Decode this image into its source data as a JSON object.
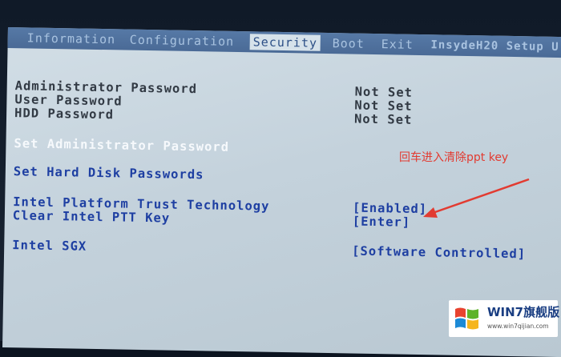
{
  "menu": {
    "tabs": [
      {
        "label": "Information"
      },
      {
        "label": "Configuration"
      },
      {
        "label": "Security"
      },
      {
        "label": "Boot"
      },
      {
        "label": "Exit"
      }
    ],
    "active_tab": "Security",
    "brand": "InsydeH20 Setup U"
  },
  "settings": [
    {
      "label": "Administrator Password",
      "value": "Not Set"
    },
    {
      "label": "User Password",
      "value": "Not Set"
    },
    {
      "label": "HDD Password",
      "value": "Not Set"
    },
    {
      "label": "Set Administrator Password"
    },
    {
      "label": "Set Hard Disk Passwords"
    },
    {
      "label": "Intel Platform Trust Technology",
      "value": "[Enabled]"
    },
    {
      "label": "Clear Intel PTT Key",
      "value": "[Enter]"
    },
    {
      "label": "Intel SGX",
      "value": "[Software Controlled]"
    }
  ],
  "annotation": {
    "text": "回车进入清除ppt key",
    "color": "#e23b31"
  },
  "watermark": {
    "title": "WIN7旗舰版",
    "url": "www.win7qijian.com"
  },
  "colors": {
    "menubar": "#4a6a96",
    "selected": "#f6f9fc",
    "option": "#1e3fa2",
    "info": "#323a44"
  }
}
